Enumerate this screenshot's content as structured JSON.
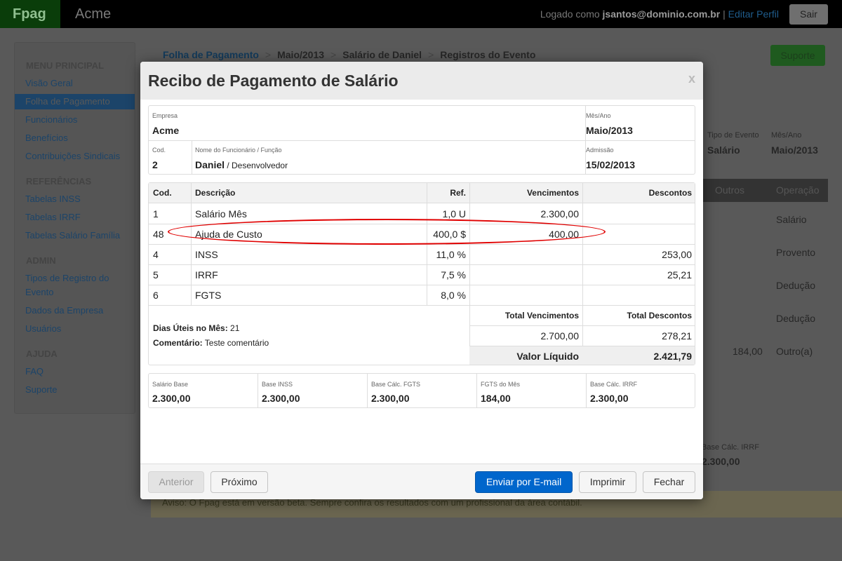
{
  "topbar": {
    "brand": "Fpag",
    "app_name": "Acme",
    "logged_prefix": "Logado como ",
    "user": "jsantos@dominio.com.br",
    "separator": " | ",
    "edit_profile": "Editar Perfil",
    "logout": "Sair"
  },
  "sidebar": {
    "sections": [
      {
        "title": "MENU PRINCIPAL",
        "items": [
          "Visão Geral",
          "Folha de Pagamento",
          "Funcionários",
          "Benefícios",
          "Contribuições Sindicais"
        ]
      },
      {
        "title": "REFERÊNCIAS",
        "items": [
          "Tabelas INSS",
          "Tabelas IRRF",
          "Tabelas Salário Família"
        ]
      },
      {
        "title": "ADMIN",
        "items": [
          "Tipos de Registro do",
          "Evento",
          "Dados da Empresa",
          "Usuários"
        ]
      },
      {
        "title": "AJUDA",
        "items": [
          "FAQ",
          "Suporte"
        ]
      }
    ],
    "active_item": "Folha de Pagamento"
  },
  "breadcrumb": [
    "Folha de Pagamento",
    "Maio/2013",
    "Salário de Daniel",
    "Registros do Evento"
  ],
  "support_button": "Suporte",
  "background": {
    "tipo_evento_label": "Tipo de Evento",
    "tipo_evento_value": "Salário",
    "mes_ano_label": "Mês/Ano",
    "mes_ano_value": "Maio/2013",
    "col_outros": "Outros",
    "col_operacao": "Operação",
    "operacoes": [
      "Salário",
      "Provento",
      "Dedução",
      "Dedução",
      "Outro(a)"
    ],
    "outros_value": "184,00",
    "base_irrf_label": "Base Cálc. IRRF",
    "base_irrf_value": "2.300,00",
    "warning": "Aviso: O Fpag está em versão beta. Sempre confira os resultados com um profissional da área contábil."
  },
  "modal": {
    "title": "Recibo de Pagamento de Salário",
    "close": "x",
    "header": {
      "empresa_label": "Empresa",
      "empresa": "Acme",
      "mes_ano_label": "Mês/Ano",
      "mes_ano": "Maio/2013",
      "cod_label": "Cod.",
      "cod": "2",
      "nome_label": "Nome do Funcionário / Função",
      "nome": "Daniel",
      "funcao": " / Desenvolvedor",
      "admissao_label": "Admissão",
      "admissao": "15/02/2013"
    },
    "table": {
      "columns": [
        "Cod.",
        "Descrição",
        "Ref.",
        "Vencimentos",
        "Descontos"
      ],
      "rows": [
        {
          "cod": "1",
          "desc": "Salário Mês",
          "ref": "1,0 U",
          "venc": "2.300,00",
          "desc_val": ""
        },
        {
          "cod": "48",
          "desc": "Ajuda de Custo",
          "ref": "400,0 $",
          "venc": "400,00",
          "desc_val": ""
        },
        {
          "cod": "4",
          "desc": "INSS",
          "ref": "11,0 %",
          "venc": "",
          "desc_val": "253,00"
        },
        {
          "cod": "5",
          "desc": "IRRF",
          "ref": "7,5 %",
          "venc": "",
          "desc_val": "25,21"
        },
        {
          "cod": "6",
          "desc": "FGTS",
          "ref": "8,0 %",
          "venc": "",
          "desc_val": ""
        }
      ],
      "dias_uteis_label": "Dias Úteis no Mês:",
      "dias_uteis": " 21",
      "comentario_label": "Comentário:",
      "comentario": " Teste comentário",
      "total_venc_label": "Total Vencimentos",
      "total_desc_label": "Total Descontos",
      "total_venc": "2.700,00",
      "total_desc": "278,21",
      "liquido_label": "Valor Líquido",
      "liquido": "2.421,79"
    },
    "bases": [
      {
        "label": "Salário Base",
        "value": "2.300,00"
      },
      {
        "label": "Base INSS",
        "value": "2.300,00"
      },
      {
        "label": "Base Cálc. FGTS",
        "value": "2.300,00"
      },
      {
        "label": "FGTS do Mês",
        "value": "184,00"
      },
      {
        "label": "Base Cálc. IRRF",
        "value": "2.300,00"
      }
    ],
    "footer": {
      "prev": "Anterior",
      "next": "Próximo",
      "email": "Enviar por E-mail",
      "print": "Imprimir",
      "close": "Fechar"
    }
  }
}
